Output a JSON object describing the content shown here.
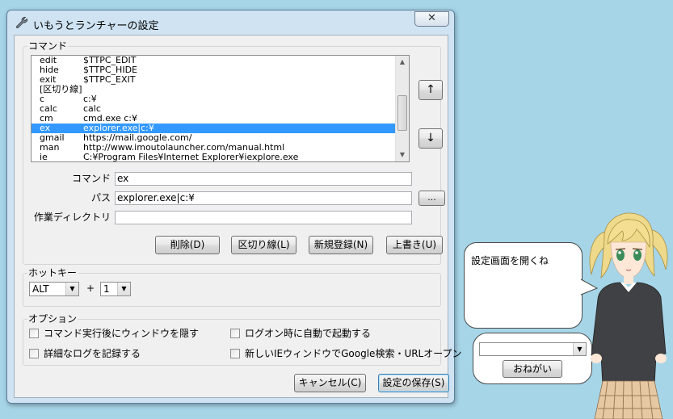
{
  "window": {
    "title": "いもうとランチャーの設定",
    "close_glyph": "✕"
  },
  "command_group": {
    "label": "コマンド",
    "rows": [
      {
        "name": "edit",
        "path": "$TTPC_EDIT",
        "selected": false
      },
      {
        "name": "hide",
        "path": "$TTPC_HIDE",
        "selected": false
      },
      {
        "name": "exit",
        "path": "$TTPC_EXIT",
        "selected": false
      },
      {
        "name": "[区切り線]",
        "path": "",
        "selected": false
      },
      {
        "name": "c",
        "path": "c:¥",
        "selected": false
      },
      {
        "name": "calc",
        "path": "calc",
        "selected": false
      },
      {
        "name": "cm",
        "path": "cmd.exe    c:¥",
        "selected": false
      },
      {
        "name": "ex",
        "path": "explorer.exe|c:¥",
        "selected": true
      },
      {
        "name": "gmail",
        "path": "https://mail.google.com/",
        "selected": false
      },
      {
        "name": "man",
        "path": "http://www.imoutolauncher.com/manual.html",
        "selected": false
      },
      {
        "name": "ie",
        "path": "C:¥Program Files¥Internet Explorer¥iexplore.exe",
        "selected": false
      }
    ],
    "up_label": "↑",
    "down_label": "↓",
    "command_label": "コマンド",
    "command_value": "ex",
    "path_label": "パス",
    "path_value": "explorer.exe|c:¥",
    "browse_label": "...",
    "workdir_label": "作業ディレクトリ",
    "workdir_value": "",
    "delete_label": "削除(D)",
    "separator_label": "区切り線(L)",
    "new_label": "新規登録(N)",
    "overwrite_label": "上書き(U)"
  },
  "hotkey_group": {
    "label": "ホットキー",
    "modifier_value": "ALT",
    "plus": "+",
    "key_value": "1"
  },
  "options_group": {
    "label": "オプション",
    "opt1": "コマンド実行後にウィンドウを隠す",
    "opt2": "ログオン時に自動で起動する",
    "opt3": "詳細なログを記録する",
    "opt4": "新しいIEウィンドウでGoogle検索・URLオープン"
  },
  "footer": {
    "cancel_label": "キャンセル(C)",
    "save_label": "設定の保存(S)"
  },
  "assistant": {
    "speech": "設定画面を開くね",
    "input_value": "",
    "ask_label": "おねがい"
  },
  "colors": {
    "desktop": "#a6d5e8",
    "selection": "#3399ff"
  }
}
